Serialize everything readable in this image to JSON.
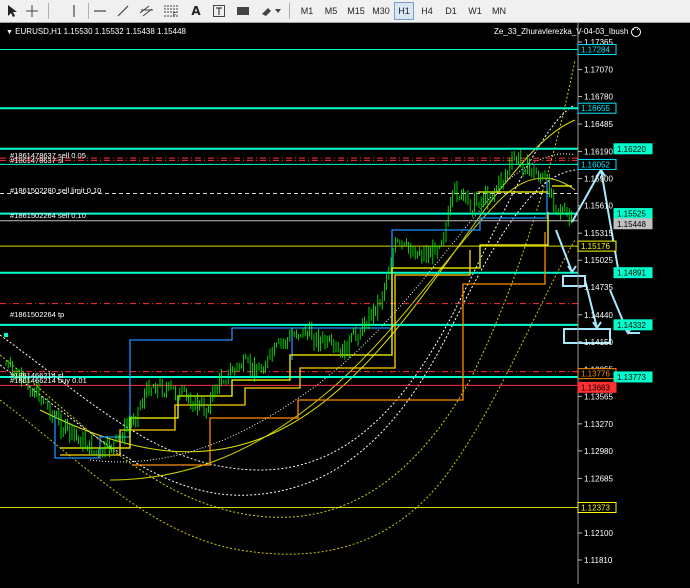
{
  "toolbar": {
    "icons": [
      "cursor-arrow-icon",
      "crosshair-icon",
      "vertical-line-icon",
      "horizontal-line-icon",
      "trendline-icon",
      "equidistant-channel-icon",
      "fibonacci-icon",
      "text-icon",
      "text-label-icon",
      "rectangle-icon",
      "shapes-dropdown-icon"
    ],
    "text_tool": "A",
    "timeframes": [
      "M1",
      "M5",
      "M15",
      "M30",
      "H1",
      "H4",
      "D1",
      "W1",
      "MN"
    ],
    "active_timeframe": "H1"
  },
  "chart": {
    "symbol_info": "EURUSD,H1  1.15530 1.15532 1.15438 1.15448",
    "indicator_label": "Ze_33_Zhuravlerezka_V-04-03_Ibush",
    "price_axis": [
      "1.17365",
      "1.17070",
      "1.16780",
      "1.16485",
      "1.16190",
      "1.15900",
      "1.15610",
      "1.15315",
      "1.15025",
      "1.14735",
      "1.14440",
      "1.14150",
      "1.13855",
      "1.13565",
      "1.13270",
      "1.12980",
      "1.12685",
      "1.12395",
      "1.12100",
      "1.11810"
    ],
    "level_labels": [
      "1.17284",
      "1.16655",
      "1.16220",
      "1.16052",
      "1.15525",
      "1.15448",
      "1.15176",
      "1.14891",
      "1.14332",
      "1.13776",
      "1.13773",
      "1.13683",
      "1.12373"
    ],
    "order_labels": [
      "#1861478637 sell 0.05",
      "#1861478637 sl",
      "#1861502280 sell limit 0.10",
      "#1861502264 sell 0.10",
      "#1861502264 tp",
      "#1861466214 sl",
      "#1861466214 buy 0.01"
    ]
  },
  "colors": {
    "candle": "#00ff00",
    "cyan_level": "#00ffcc",
    "blue_step": "#1e90ff",
    "orange_step": "#ff8c00",
    "yellow_step": "#ffff00",
    "arrow": "#a8e8ff"
  }
}
